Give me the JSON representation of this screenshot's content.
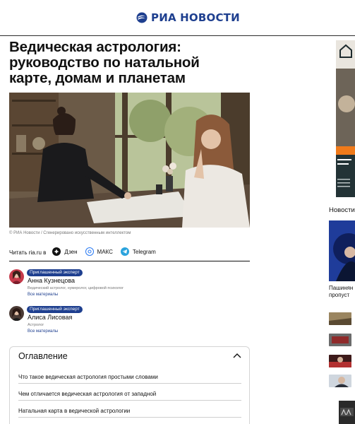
{
  "site": {
    "logo_text": "РИА НОВОСТИ",
    "brand_color": "#1e3f8f"
  },
  "article": {
    "title": "Ведическая астрология: руководство по натальной карте, домам и планетам",
    "photo_caption": "© РИА Новости / Сгенерировано искусственным интеллектом"
  },
  "share": {
    "label": "Читать ria.ru в",
    "items": [
      {
        "label": "Дзен",
        "icon": "dzen-icon",
        "color": "#111111"
      },
      {
        "label": "МАКС",
        "icon": "max-icon",
        "color": "#2b7bf3"
      },
      {
        "label": "Telegram",
        "icon": "telegram-icon",
        "color": "#2aa3dd"
      }
    ]
  },
  "experts": [
    {
      "badge": "Приглашенный эксперт",
      "name": "Анна Кузнецова",
      "role": "Ведический астролог, нумеролог, цифровой психолог",
      "more": "Все материалы"
    },
    {
      "badge": "Приглашенный эксперт",
      "name": "Алиса Лисовая",
      "role": "Астролог",
      "more": "Все материалы"
    }
  ],
  "toc": {
    "title": "Оглавление",
    "items": [
      "Что такое ведическая астрология простыми словами",
      "Чем отличается ведическая астрология от западной",
      "Натальная карта в ведической астрологии"
    ]
  },
  "sidebar": {
    "section_label": "Новости",
    "headline_lines": [
      "Пашинян",
      "пропуст"
    ]
  }
}
